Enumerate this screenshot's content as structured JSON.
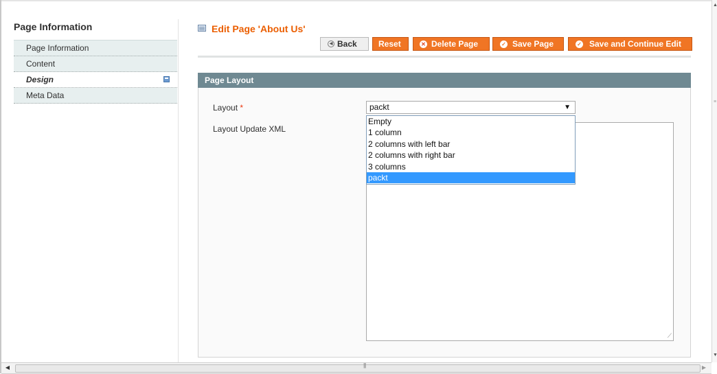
{
  "sidebar": {
    "title": "Page Information",
    "items": [
      {
        "label": "Page Information"
      },
      {
        "label": "Content"
      },
      {
        "label": "Design"
      },
      {
        "label": "Meta Data"
      }
    ]
  },
  "header": {
    "title": "Edit Page 'About Us'"
  },
  "toolbar": {
    "back_label": "Back",
    "reset_label": "Reset",
    "delete_label": "Delete Page",
    "save_label": "Save Page",
    "save_continue_label": "Save and Continue Edit"
  },
  "fieldset": {
    "title": "Page Layout",
    "layout_label": "Layout",
    "required_mark": "*",
    "layout_xml_label": "Layout Update XML",
    "layout_select": {
      "selected": "packt",
      "options": [
        "Empty",
        "1 column",
        "2 columns with left bar",
        "2 columns with right bar",
        "3 columns",
        "packt"
      ]
    },
    "layout_xml_value": ""
  },
  "colors": {
    "accent": "#eb5e00",
    "button": "#f07524",
    "fieldset_header": "#6f8992",
    "selected_option": "#3399ff"
  }
}
